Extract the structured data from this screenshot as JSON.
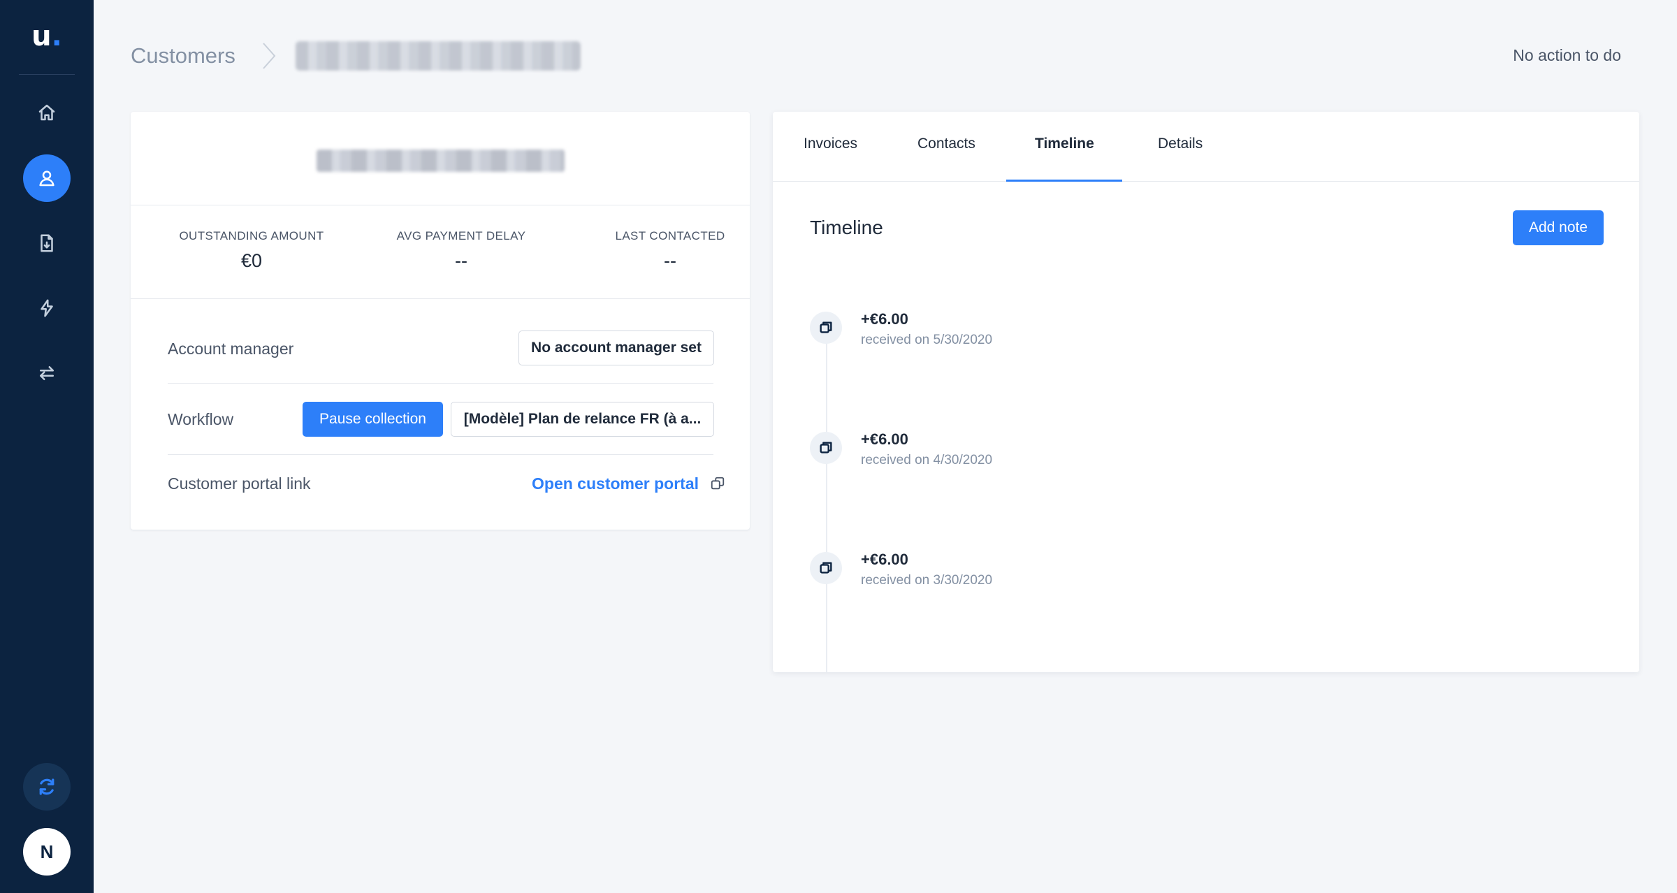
{
  "brand": {
    "logo_text": "u",
    "logo_dot": ".",
    "accent": "#2d7ff9",
    "sidebar_bg": "#0c2340"
  },
  "sidebar": {
    "items": [
      {
        "icon": "home-icon",
        "active": false
      },
      {
        "icon": "user-icon",
        "active": true
      },
      {
        "icon": "invoice-icon",
        "active": false
      },
      {
        "icon": "lightning-icon",
        "active": false
      },
      {
        "icon": "transfer-arrows-icon",
        "active": false
      }
    ],
    "sync_icon": "refresh-icon",
    "avatar_initial": "N"
  },
  "header": {
    "breadcrumb_root": "Customers",
    "status": "No action to do"
  },
  "customer_card": {
    "stats": [
      {
        "label": "OUTSTANDING AMOUNT",
        "value": "€0"
      },
      {
        "label": "AVG PAYMENT DELAY",
        "value": "--"
      },
      {
        "label": "LAST CONTACTED",
        "value": "--"
      }
    ],
    "account_manager": {
      "label": "Account manager",
      "button": "No account manager set"
    },
    "workflow": {
      "label": "Workflow",
      "pause_button": "Pause collection",
      "workflow_button": "[Modèle] Plan de relance FR (à a..."
    },
    "portal": {
      "label": "Customer portal link",
      "link": "Open customer portal"
    }
  },
  "tabs": [
    {
      "label": "Invoices",
      "active": false
    },
    {
      "label": "Contacts",
      "active": false
    },
    {
      "label": "Timeline",
      "active": true
    },
    {
      "label": "Details",
      "active": false
    }
  ],
  "timeline": {
    "title": "Timeline",
    "add_note": "Add note",
    "items": [
      {
        "amount": "+€6.00",
        "date": "received on 5/30/2020"
      },
      {
        "amount": "+€6.00",
        "date": "received on 4/30/2020"
      },
      {
        "amount": "+€6.00",
        "date": "received on 3/30/2020"
      }
    ]
  }
}
